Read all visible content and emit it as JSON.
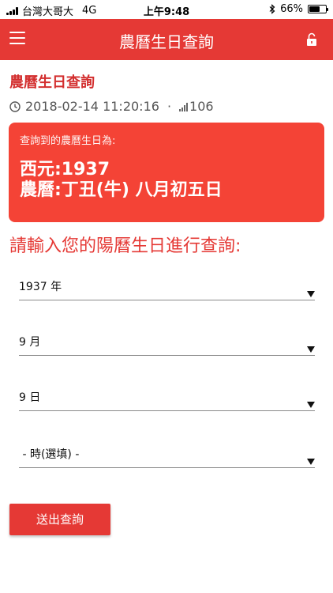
{
  "status_bar": {
    "carrier": "台灣大哥大",
    "network": "4G",
    "time": "上午9:48",
    "battery": "66%",
    "battery_level": 0.66,
    "bluetooth_icon": "bluetooth-icon"
  },
  "app_bar": {
    "title": "農曆生日查詢",
    "menu_icon": "hamburger-menu-icon",
    "lock_icon": "lock-icon",
    "color": "#e53935"
  },
  "page": {
    "title": "農曆生日查詢",
    "timestamp": "2018-02-14 11:20:16",
    "separator": "·",
    "view_count": "106",
    "clock_icon": "clock-icon",
    "signal_icon": "signal-bars-icon"
  },
  "result": {
    "caption": "查詢到的農曆生日為:",
    "western_line": "西元:1937",
    "lunar_line": "農曆:丁丑(牛) 八月初五日",
    "color": "#f44336"
  },
  "form": {
    "prompt": "請輸入您的陽曆生日進行查詢:",
    "year_value": "1937 年",
    "month_value": "9 月",
    "day_value": "9 日",
    "hour_value": " - 時(選填) -",
    "submit_label": "送出查詢"
  }
}
